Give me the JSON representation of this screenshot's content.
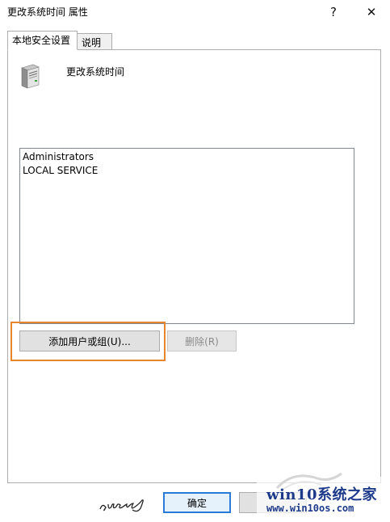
{
  "window": {
    "title": "更改系统时间 属性",
    "help_glyph": "?",
    "close_glyph": "✕"
  },
  "tabs": [
    {
      "label": "本地安全设置",
      "active": true
    },
    {
      "label": "说明",
      "active": false
    }
  ],
  "policy": {
    "icon": "server-icon",
    "name": "更改系统时间"
  },
  "accounts": [
    "Administrators",
    "LOCAL SERVICE"
  ],
  "buttons": {
    "add": "添加用户或组(U)...",
    "remove": "删除(R)",
    "ok": "确定",
    "cancel": ""
  },
  "signature": "query",
  "watermark": {
    "title": "win10系统之家",
    "url": "www.win10os.com"
  },
  "colors": {
    "highlight": "#e8852f",
    "ok_border": "#2a7ad8",
    "watermark": "#1d3a8a"
  }
}
